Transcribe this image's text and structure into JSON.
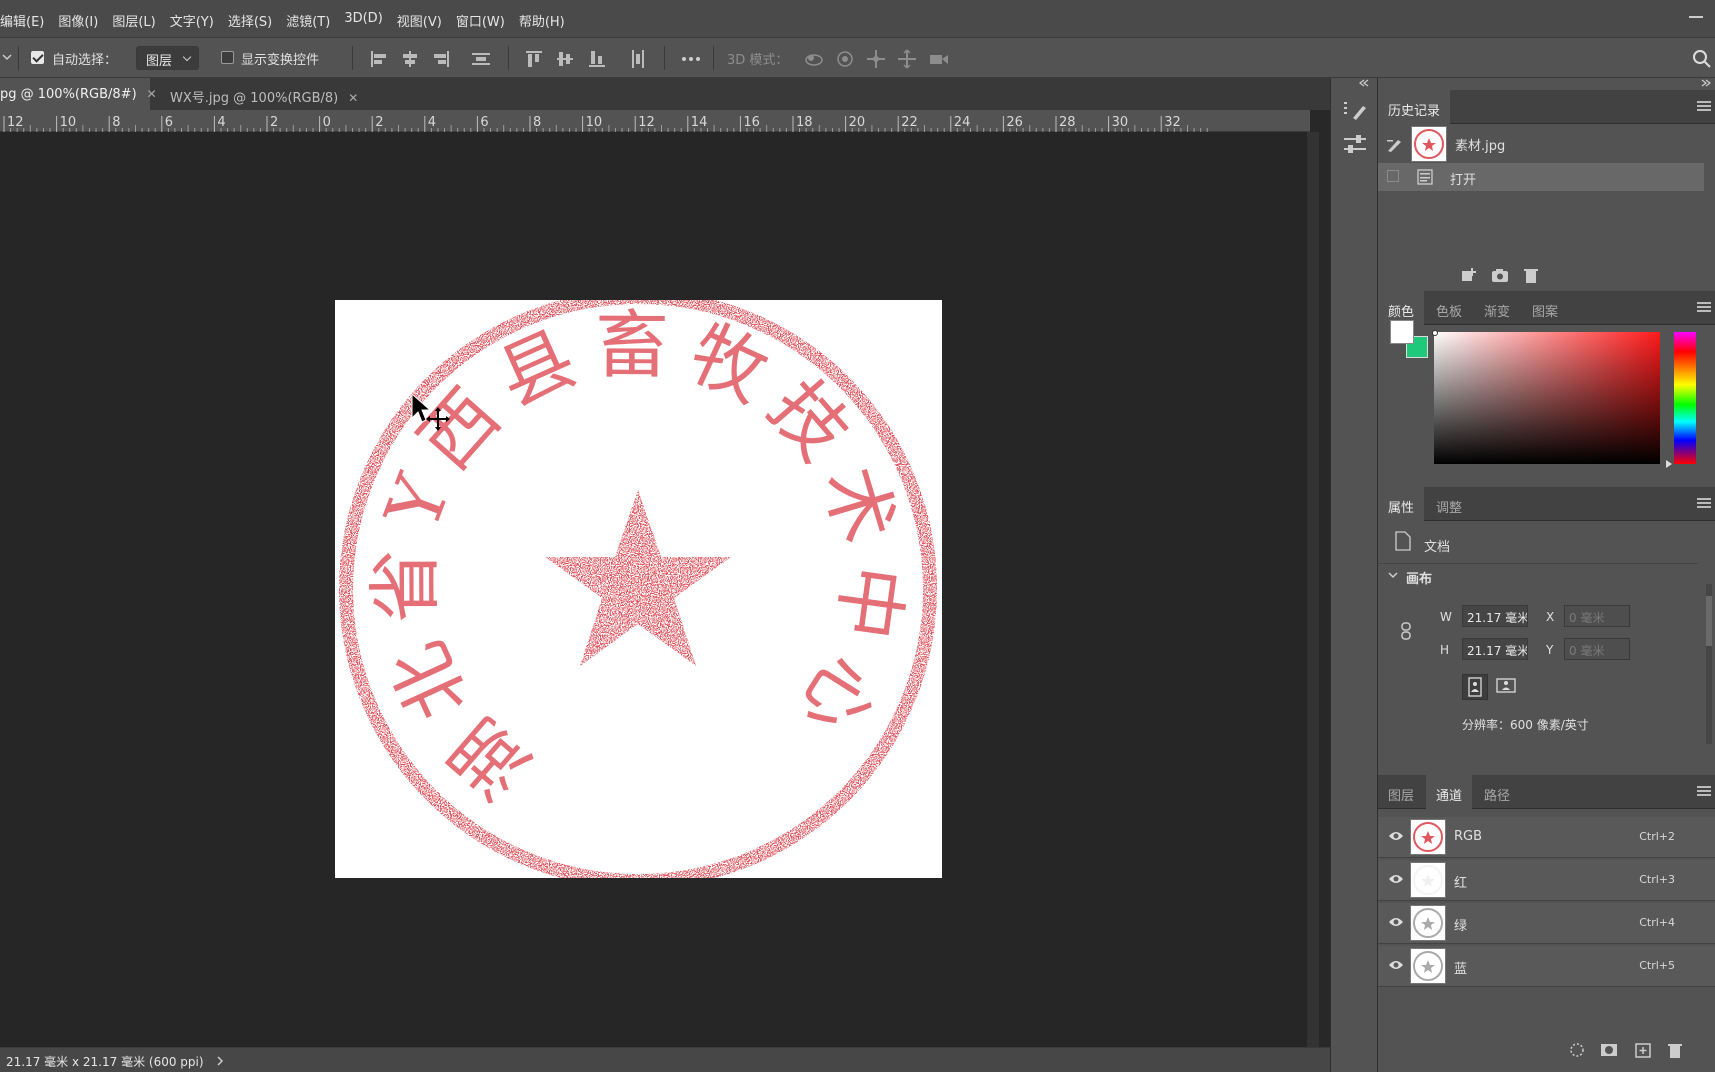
{
  "menu": [
    "编辑(E)",
    "图像(I)",
    "图层(L)",
    "文字(Y)",
    "选择(S)",
    "滤镜(T)",
    "3D(D)",
    "视图(V)",
    "窗口(W)",
    "帮助(H)"
  ],
  "options": {
    "auto_select_label": "自动选择：",
    "auto_select_checked": true,
    "auto_select_value": "图层",
    "show_transform_label": "显示变换控件",
    "show_transform_checked": false,
    "mode_3d_label": "3D 模式："
  },
  "tabs": [
    {
      "label": "pg @ 100%(RGB/8#)",
      "active": true
    },
    {
      "label": "WX号.jpg @ 100%(RGB/8)",
      "active": false
    }
  ],
  "ruler_labels": [
    "12",
    "10",
    "8",
    "6",
    "4",
    "2",
    "0",
    "2",
    "4",
    "6",
    "8",
    "10",
    "12",
    "14",
    "16",
    "18",
    "20",
    "22",
    "24",
    "26",
    "28",
    "30",
    "32"
  ],
  "stamp": {
    "text": "湖北省Y西县畜牧技术中心",
    "color": "#e0575f"
  },
  "status_text": "21.17 毫米 x 21.17 毫米 (600 ppi)",
  "history": {
    "tab": "历史记录",
    "snapshot": "素材.jpg",
    "step": "打开"
  },
  "color_panel": {
    "tabs": [
      "颜色",
      "色板",
      "渐变",
      "图案"
    ],
    "active": "颜色",
    "fg": "#ffffff",
    "bg": "#1fc87a",
    "hue": "#ff1a1a"
  },
  "properties": {
    "tabs": [
      "属性",
      "调整"
    ],
    "doc_label": "文档",
    "section": "画布",
    "w_label": "W",
    "w_value": "21.17 毫米",
    "h_label": "H",
    "h_value": "21.17 毫米",
    "x_label": "X",
    "x_placeholder": "0 毫米",
    "y_label": "Y",
    "y_placeholder": "0 毫米",
    "resolution": "分辨率：600 像素/英寸"
  },
  "channels": {
    "tabs": [
      "图层",
      "通道",
      "路径"
    ],
    "active": "通道",
    "rows": [
      {
        "name": "RGB",
        "shortcut": "Ctrl+2"
      },
      {
        "name": "红",
        "shortcut": "Ctrl+3"
      },
      {
        "name": "绿",
        "shortcut": "Ctrl+4"
      },
      {
        "name": "蓝",
        "shortcut": "Ctrl+5"
      }
    ]
  }
}
